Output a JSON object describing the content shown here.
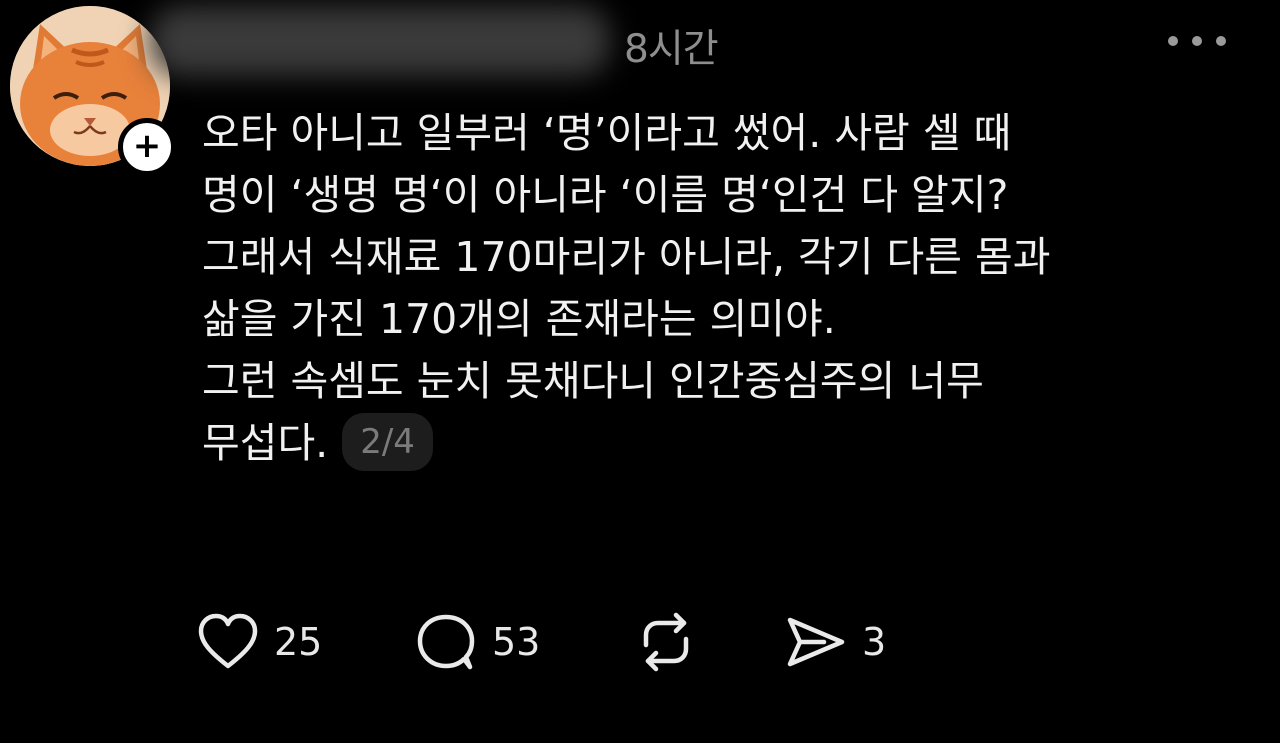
{
  "post": {
    "timestamp": "8시간",
    "lines": [
      "오타 아니고 일부러 ‘명’이라고 썼어. 사람 셀 때",
      "명이 ‘생명 명‘이 아니라 ‘이름 명‘인건 다 알지?",
      "그래서 식재료 170마리가 아니라, 각기 다른 몸과",
      "삶을 가진 170개의 존재라는 의미야.",
      "그런 속셈도 눈치 못채다니 인간중심주의 너무",
      "무섭다."
    ],
    "page_indicator": "2/4"
  },
  "actions": {
    "likes": "25",
    "comments": "53",
    "shares": "3"
  },
  "icons": {
    "avatar": "cat-avatar",
    "follow": "plus-icon",
    "more": "more-dots-icon",
    "like": "heart-icon",
    "comment": "speech-bubble-icon",
    "repost": "repost-icon",
    "share": "send-icon"
  },
  "colors": {
    "background": "#000000",
    "text": "#f1f1f1",
    "muted": "#8e8e8e",
    "avatar_orange": "#e8813a"
  }
}
